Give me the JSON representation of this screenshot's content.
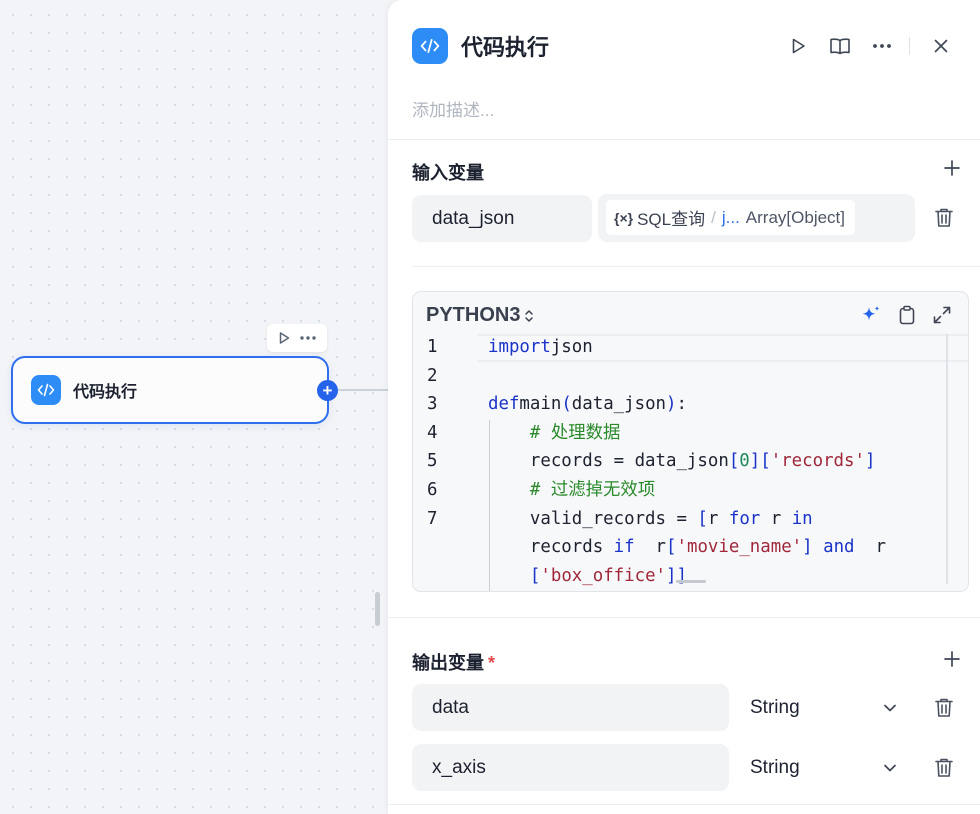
{
  "canvas": {
    "node": {
      "title": "代码执行",
      "add_symbol": "+"
    }
  },
  "panel": {
    "title": "代码执行",
    "description_placeholder": "添加描述...",
    "input_section": {
      "title": "输入变量",
      "variable_name": "data_json",
      "ref_source": "SQL查询",
      "ref_field": "j...",
      "ref_type": "Array[Object]"
    },
    "code": {
      "language": "PYTHON3",
      "lines": [
        {
          "n": "1",
          "segs": [
            [
              "kw",
              "import"
            ],
            [
              "",
              "json"
            ]
          ]
        },
        {
          "n": "2",
          "segs": []
        },
        {
          "n": "3",
          "segs": [
            [
              "kw",
              "def"
            ],
            [
              "",
              "main"
            ],
            [
              "kw",
              "("
            ],
            [
              "",
              "data_json"
            ],
            [
              "kw",
              ")"
            ],
            [
              "",
              ":"
            ]
          ]
        },
        {
          "n": "4",
          "segs": [
            [
              "",
              "    "
            ],
            [
              "cm",
              "# 处理数据"
            ]
          ]
        },
        {
          "n": "5",
          "segs": [
            [
              "",
              "    records = data_json"
            ],
            [
              "kw",
              "["
            ],
            [
              "num",
              "0"
            ],
            [
              "kw",
              "]["
            ],
            [
              "str",
              "'records'"
            ],
            [
              "kw",
              "]"
            ]
          ]
        },
        {
          "n": "6",
          "segs": [
            [
              "",
              "    "
            ],
            [
              "cm",
              "# 过滤掉无效项"
            ]
          ]
        },
        {
          "n": "7",
          "segs": [
            [
              "",
              "    valid_records = "
            ],
            [
              "kw",
              "["
            ],
            [
              "",
              "r "
            ],
            [
              "kw",
              "for"
            ],
            [
              "",
              ""
            ],
            [
              "",
              "r "
            ],
            [
              "kw",
              "in"
            ]
          ]
        },
        {
          "n": "",
          "segs": [
            [
              "",
              "    records "
            ],
            [
              "kw",
              "if"
            ],
            [
              "",
              " r"
            ],
            [
              "kw",
              "["
            ],
            [
              "str",
              "'movie_name'"
            ],
            [
              "kw",
              "]"
            ],
            [
              "",
              " "
            ],
            [
              "kw",
              "and"
            ],
            [
              "",
              " r"
            ]
          ]
        },
        {
          "n": "",
          "segs": [
            [
              "",
              "    "
            ],
            [
              "kw",
              "["
            ],
            [
              "str",
              "'box_office'"
            ],
            [
              "kw",
              "]]"
            ]
          ]
        }
      ]
    },
    "output_section": {
      "title": "输出变量",
      "required_mark": "*",
      "variables": [
        {
          "name": "data",
          "type": "String"
        },
        {
          "name": "x_axis",
          "type": "String"
        }
      ]
    }
  }
}
